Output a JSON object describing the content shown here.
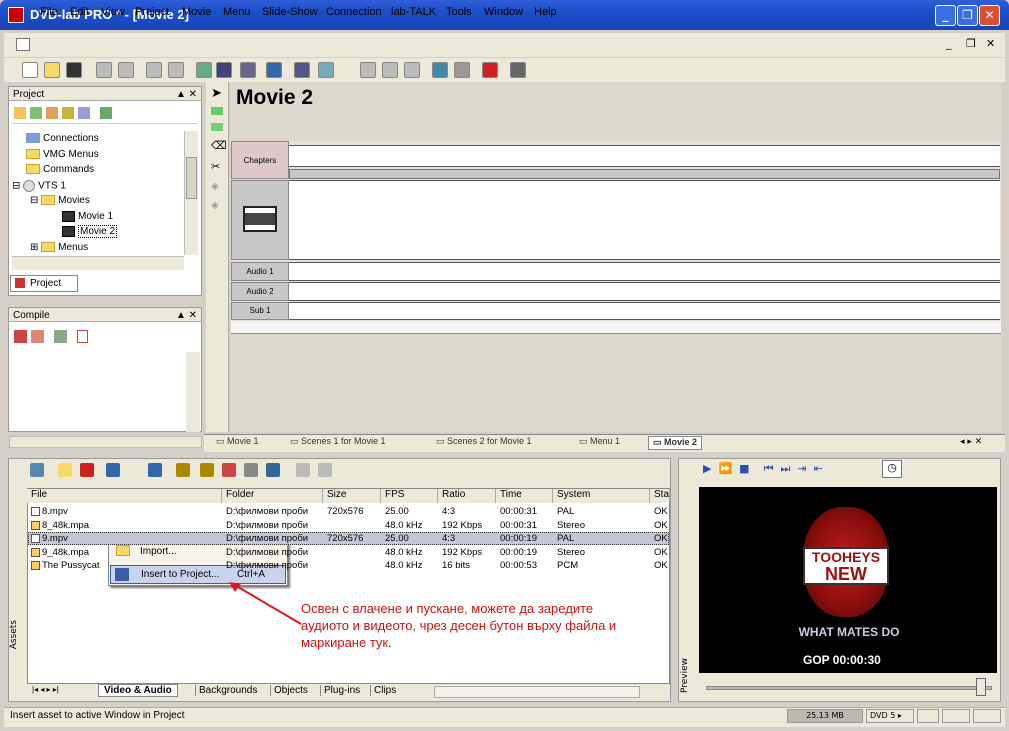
{
  "window": {
    "title": "DVD-lab PRO * - [Movie 2]",
    "min": "_",
    "max": "❐",
    "close": "✕"
  },
  "menu": [
    "File",
    "Edit",
    "View",
    "Project",
    "Movie",
    "Menu",
    "Slide-Show",
    "Connection",
    "lab-TALK",
    "Tools",
    "Window",
    "Help"
  ],
  "project_panel": {
    "title": "Project",
    "tab": "Project",
    "tree": [
      "Connections",
      "VMG Menus",
      "Commands",
      "VTS 1",
      "Movies",
      "Movie 1",
      "Movie 2",
      "Menus"
    ]
  },
  "compile_panel": {
    "title": "Compile"
  },
  "editor": {
    "movie_title": "Movie 2",
    "tracks": [
      "Chapters",
      "Audio 1",
      "Audio 2",
      "Sub 1"
    ]
  },
  "doc_tabs": [
    "Movie 1",
    "Scenes 1 for Movie 1",
    "Scenes 2 for Movie 1",
    "Menu 1",
    "Movie 2"
  ],
  "assets": {
    "side_label": "Assets",
    "columns": [
      "File",
      "Folder",
      "Size",
      "FPS",
      "Ratio",
      "Time",
      "System",
      "Sta"
    ],
    "rows": [
      [
        "8.mpv",
        "D:\\филмови проби",
        "720x576",
        "25.00",
        "4:3",
        "00:00:31",
        "PAL",
        "OK"
      ],
      [
        "8_48k.mpa",
        "D:\\филмови проби",
        "",
        "48.0 kHz",
        "192 Kbps",
        "00:00:31",
        "Stereo",
        "OK"
      ],
      [
        "9.mpv",
        "D:\\филмови проби",
        "720x576",
        "25.00",
        "4:3",
        "00:00:19",
        "PAL",
        "OK"
      ],
      [
        "9_48k.mpa",
        "D:\\филмови проби",
        "",
        "48.0 kHz",
        "192 Kbps",
        "00:00:19",
        "Stereo",
        "OK"
      ],
      [
        "The Pussycat",
        "D:\\филмови проби",
        "",
        "48.0 kHz",
        "16 bits",
        "00:00:53",
        "PCM",
        "OK"
      ]
    ],
    "tabs": [
      "Video & Audio",
      "Backgrounds",
      "Objects",
      "Plug-ins",
      "Clips"
    ]
  },
  "context_menu": {
    "import": "Import...",
    "insert": "Insert to Project...",
    "shortcut": "Ctrl+A"
  },
  "annotation": "Освен с влачене и пускане, можете да заредите аудиото и видеото, чрез десен бутон върху файла и маркиране тук.",
  "preview": {
    "label": "Preview",
    "gop": "GOP 00:00:30",
    "logo_top": "TOOHEYS",
    "logo_bottom": "NEW",
    "tagline": "WHAT MATES DO"
  },
  "status": {
    "text": "Insert asset to active Window in Project",
    "size": "25.13 MB",
    "disc": "DVD 5"
  },
  "colors": {
    "title_blue": "#1b4fc8",
    "annotation_red": "#d01010",
    "arrow_red": "#e01818"
  }
}
